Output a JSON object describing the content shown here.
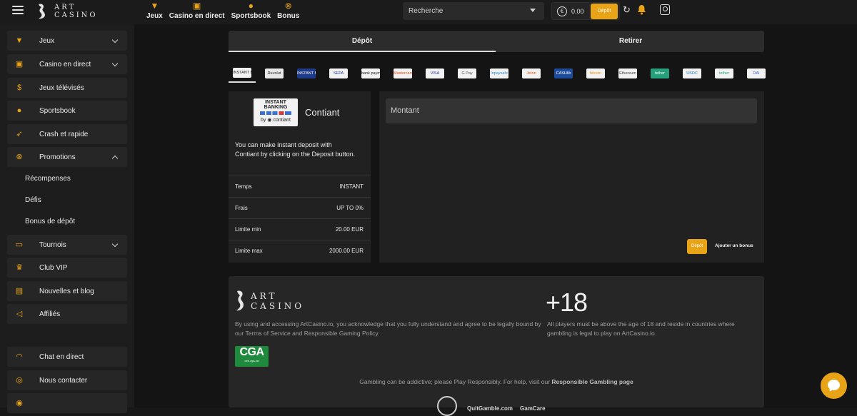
{
  "header": {
    "logo_line1": "ART",
    "logo_line2": "CASINO",
    "nav": [
      {
        "label": "Jeux",
        "icon": "slot-icon"
      },
      {
        "label": "Casino en direct",
        "icon": "cards-icon"
      },
      {
        "label": "Sportsbook",
        "icon": "basketball-icon"
      },
      {
        "label": "Bonus",
        "icon": "percent-icon"
      }
    ],
    "search_placeholder": "Recherche",
    "balance": "0.00",
    "deposit_label": "Dépôt",
    "accent_color": "#e9a317"
  },
  "sidebar": {
    "items": [
      {
        "label": "Jeux",
        "icon": "slot-icon",
        "expandable": true
      },
      {
        "label": "Casino en direct",
        "icon": "cards-icon",
        "expandable": true
      },
      {
        "label": "Jeux télévisés",
        "icon": "dollar-icon",
        "expandable": false
      },
      {
        "label": "Sportsbook",
        "icon": "basketball-icon",
        "expandable": false
      },
      {
        "label": "Crash et rapide",
        "icon": "rocket-icon",
        "expandable": false
      },
      {
        "label": "Promotions",
        "icon": "percent-icon",
        "expandable": true,
        "expanded": true
      },
      {
        "label": "Tournois",
        "icon": "ticket-icon",
        "expandable": true
      },
      {
        "label": "Club VIP",
        "icon": "crown-icon",
        "expandable": false
      },
      {
        "label": "Nouvelles et blog",
        "icon": "chat-icon",
        "expandable": false
      },
      {
        "label": "Affiliés",
        "icon": "megaphone-icon",
        "expandable": false
      },
      {
        "label": "Chat en direct",
        "icon": "headset-icon",
        "expandable": false
      },
      {
        "label": "Nous contacter",
        "icon": "message-icon",
        "expandable": false
      }
    ],
    "sub_items": [
      "Récompenses",
      "Défis",
      "Bonus de dépôt"
    ]
  },
  "cashier": {
    "tabs": [
      "Dépôt",
      "Retirer"
    ],
    "active_tab": 0,
    "methods": [
      {
        "name": "INSTANT BANKING",
        "color": "#f2f2f2",
        "text": "#222"
      },
      {
        "name": "Revolut",
        "color": "#e8e8e8",
        "text": "#222"
      },
      {
        "name": "INSTANT BANKING",
        "color": "#1e3b8a",
        "text": "#fff"
      },
      {
        "name": "SEPA",
        "color": "#f2f2f2",
        "text": "#1e3b8a"
      },
      {
        "name": "bank payment",
        "color": "#f2f2f2",
        "text": "#222"
      },
      {
        "name": "Mastercard",
        "color": "#f2f2f2",
        "text": "#e84a1b"
      },
      {
        "name": "VISA",
        "color": "#f2f2f2",
        "text": "#1a2f8f"
      },
      {
        "name": "G Pay",
        "color": "#f2f2f2",
        "text": "#555"
      },
      {
        "name": "Inpaysafe",
        "color": "#f2f2f2",
        "text": "#2a8fd6"
      },
      {
        "name": "Jeton",
        "color": "#f2f2f2",
        "text": "#e8581b"
      },
      {
        "name": "CASHlib",
        "color": "#1e4b9a",
        "text": "#fff"
      },
      {
        "name": "bitcoin",
        "color": "#f2f2f2",
        "text": "#e89317"
      },
      {
        "name": "Ethereum",
        "color": "#f2f2f2",
        "text": "#444"
      },
      {
        "name": "tether",
        "color": "#26a17b",
        "text": "#fff"
      },
      {
        "name": "USDC",
        "color": "#f2f2f2",
        "text": "#2775ca"
      },
      {
        "name": "tether",
        "color": "#f2f2f2",
        "text": "#26a17b"
      },
      {
        "name": "DAI",
        "color": "#f2f2f2",
        "text": "#3a5fd6"
      }
    ],
    "active_method": 0,
    "provider": {
      "logo_title": "INSTANT BANKING",
      "logo_by": "by",
      "logo_brand": "contiant",
      "name": "Contiant",
      "description": "You can make instant deposit with Contiant by clicking on the Deposit button.",
      "info": [
        {
          "label": "Temps",
          "value": "INSTANT"
        },
        {
          "label": "Frais",
          "value": "UP TO 0%"
        },
        {
          "label": "Limite min",
          "value": "20.00 EUR"
        },
        {
          "label": "Limite max",
          "value": "2000.00 EUR"
        }
      ]
    },
    "amount_placeholder": "Montant",
    "deposit_button": "Dépôt",
    "bonus_link": "Ajouter un bonus"
  },
  "footer": {
    "logo_line1": "ART",
    "logo_line2": "CASINO",
    "legal": "By using and accessing ArtCasino.io, you acknowledge that you fully understand and agree to be legally bound by our Terms of Service and Responsible Gaming Policy.",
    "age_badge": "+18",
    "age_text": "All players must be above the age of 18 and reside in countries where gambling is legal to play on ArtCasino.io.",
    "cga_title": "CGA",
    "cga_sub": "cert.cga.cw",
    "responsible_prefix": "Gambling can be addictive; please Play Responsibly. For help, visit our ",
    "responsible_link": "Responsible Gambling page",
    "badges": [
      "QuitGamble.com",
      "GamCare"
    ]
  }
}
